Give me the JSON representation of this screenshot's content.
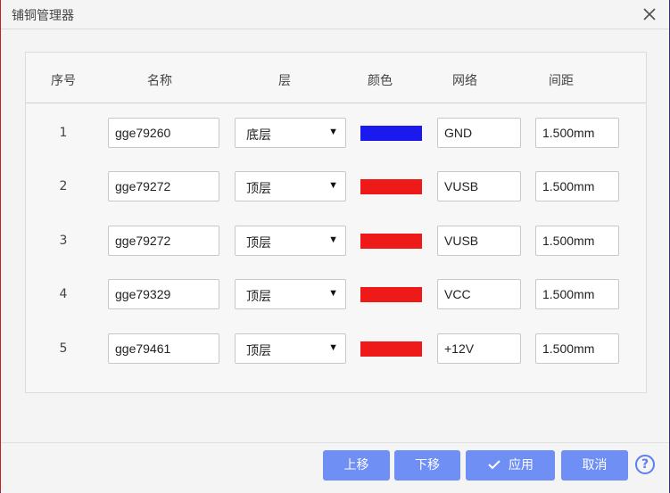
{
  "dialog": {
    "title": "铺铜管理器"
  },
  "table": {
    "headers": [
      "序号",
      "名称",
      "层",
      "颜色",
      "网络",
      "间距"
    ],
    "rows": [
      {
        "index": "1",
        "name": "gge79260",
        "layer": "底层",
        "color": "#1a1aee",
        "net": "GND",
        "clearance": "1.500mm"
      },
      {
        "index": "2",
        "name": "gge79272",
        "layer": "顶层",
        "color": "#ee1a1a",
        "net": "VUSB",
        "clearance": "1.500mm"
      },
      {
        "index": "3",
        "name": "gge79272",
        "layer": "顶层",
        "color": "#ee1a1a",
        "net": "VUSB",
        "clearance": "1.500mm"
      },
      {
        "index": "4",
        "name": "gge79329",
        "layer": "顶层",
        "color": "#ee1a1a",
        "net": "VCC",
        "clearance": "1.500mm"
      },
      {
        "index": "5",
        "name": "gge79461",
        "layer": "顶层",
        "color": "#ee1a1a",
        "net": "+12V",
        "clearance": "1.500mm"
      }
    ]
  },
  "footer": {
    "move_up": "上移",
    "move_down": "下移",
    "apply": "应用",
    "cancel": "取消",
    "help_glyph": "?"
  },
  "colors": {
    "accent": "#6f8ff5",
    "help": "#5a7ff0"
  }
}
